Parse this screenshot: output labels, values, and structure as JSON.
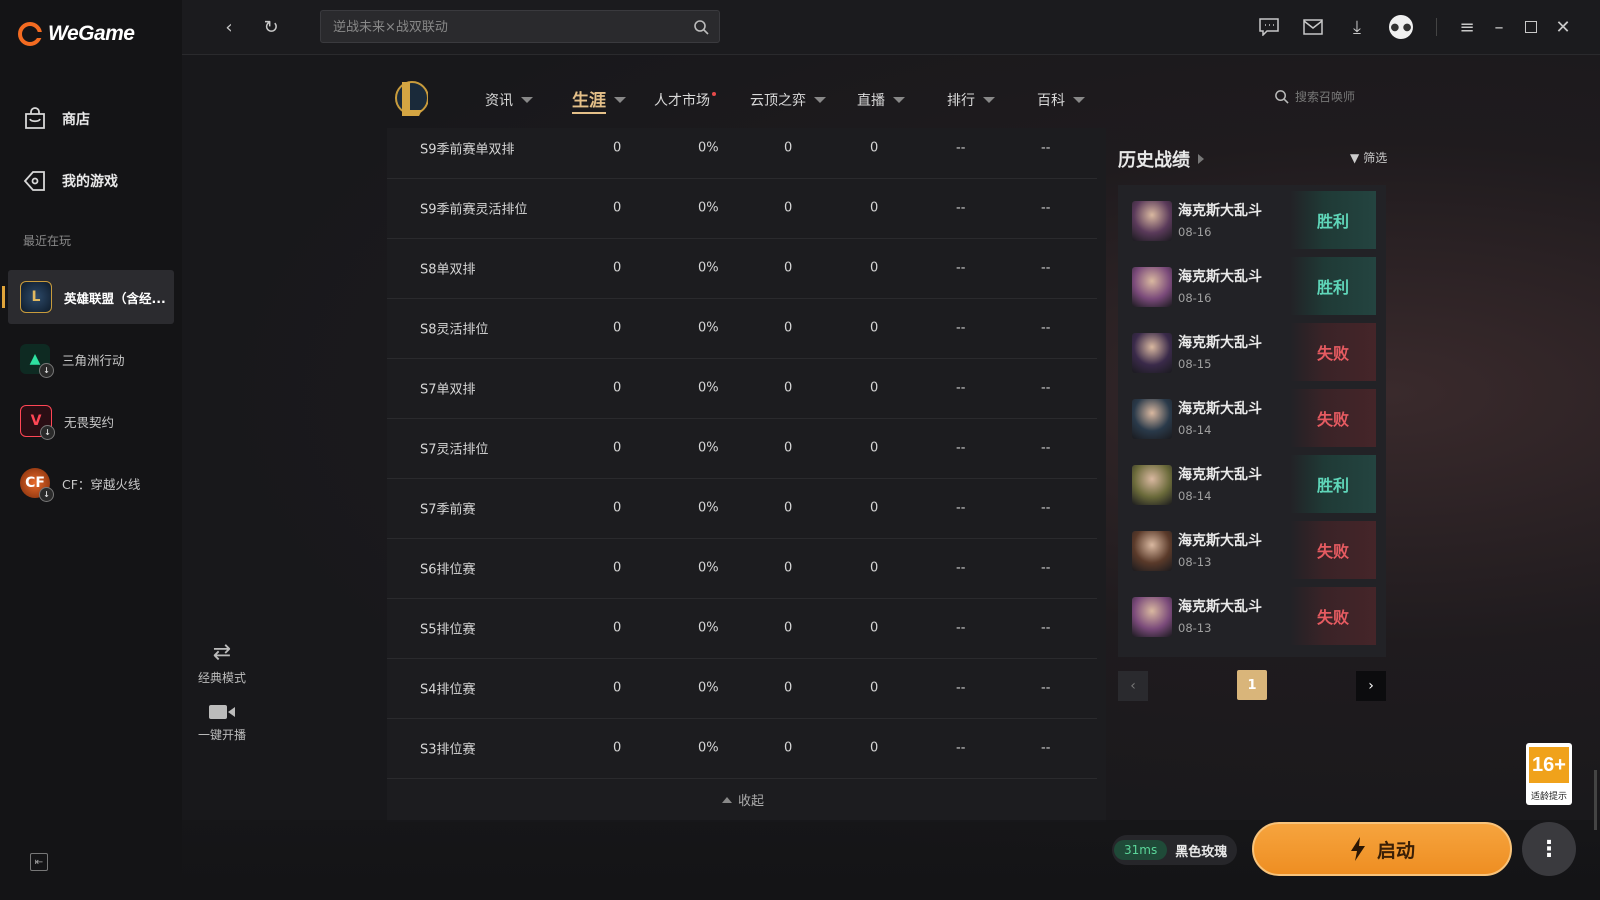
{
  "app": {
    "name": "WeGame"
  },
  "sidebar": {
    "store_label": "商店",
    "mygames_label": "我的游戏",
    "recent_label": "最近在玩",
    "games": [
      {
        "name": "英雄联盟（含经...",
        "active": true
      },
      {
        "name": "三角洲行动"
      },
      {
        "name": "无畏契约"
      },
      {
        "name": "CF：穿越火线"
      }
    ]
  },
  "topbar": {
    "search_placeholder": "逆战未来×战双联动"
  },
  "game_nav": {
    "tabs": [
      {
        "label": "资讯"
      },
      {
        "label": "生涯",
        "active": true
      },
      {
        "label": "人才市场"
      },
      {
        "label": "云顶之弈"
      },
      {
        "label": "直播"
      },
      {
        "label": "排行"
      },
      {
        "label": "百科"
      }
    ],
    "summoner_search_placeholder": "搜索召唤师"
  },
  "career_table": {
    "rows": [
      [
        "S9季前赛单双排",
        "0",
        "0%",
        "0",
        "0",
        "--",
        "--"
      ],
      [
        "S9季前赛灵活排位",
        "0",
        "0%",
        "0",
        "0",
        "--",
        "--"
      ],
      [
        "S8单双排",
        "0",
        "0%",
        "0",
        "0",
        "--",
        "--"
      ],
      [
        "S8灵活排位",
        "0",
        "0%",
        "0",
        "0",
        "--",
        "--"
      ],
      [
        "S7单双排",
        "0",
        "0%",
        "0",
        "0",
        "--",
        "--"
      ],
      [
        "S7灵活排位",
        "0",
        "0%",
        "0",
        "0",
        "--",
        "--"
      ],
      [
        "S7季前赛",
        "0",
        "0%",
        "0",
        "0",
        "--",
        "--"
      ],
      [
        "S6排位赛",
        "0",
        "0%",
        "0",
        "0",
        "--",
        "--"
      ],
      [
        "S5排位赛",
        "0",
        "0%",
        "0",
        "0",
        "--",
        "--"
      ],
      [
        "S4排位赛",
        "0",
        "0%",
        "0",
        "0",
        "--",
        "--"
      ],
      [
        "S3排位赛",
        "0",
        "0%",
        "0",
        "0",
        "--",
        "--"
      ]
    ],
    "collapse_label": "收起"
  },
  "history": {
    "title": "历史战绩",
    "filter_label": "筛选",
    "matches": [
      {
        "mode": "海克斯大乱斗",
        "date": "08-16",
        "result": "胜利",
        "win": true,
        "color": "#5a3a5a"
      },
      {
        "mode": "海克斯大乱斗",
        "date": "08-16",
        "result": "胜利",
        "win": true,
        "color": "#7a4a7a"
      },
      {
        "mode": "海克斯大乱斗",
        "date": "08-15",
        "result": "失败",
        "win": false,
        "color": "#3a2a4a"
      },
      {
        "mode": "海克斯大乱斗",
        "date": "08-14",
        "result": "失败",
        "win": false,
        "color": "#2a3a4a"
      },
      {
        "mode": "海克斯大乱斗",
        "date": "08-14",
        "result": "胜利",
        "win": true,
        "color": "#6a6a3a"
      },
      {
        "mode": "海克斯大乱斗",
        "date": "08-13",
        "result": "失败",
        "win": false,
        "color": "#5a3a2a"
      },
      {
        "mode": "海克斯大乱斗",
        "date": "08-13",
        "result": "失败",
        "win": false,
        "color": "#7a4a7a"
      }
    ],
    "current_page": "1"
  },
  "side_actions": {
    "mode_label": "经典模式",
    "stream_label": "一键开播"
  },
  "bottom": {
    "ping": "31ms",
    "server": "黑色玫瑰",
    "launch_label": "启动",
    "age_rating": "16+",
    "age_tip": "适龄提示"
  }
}
